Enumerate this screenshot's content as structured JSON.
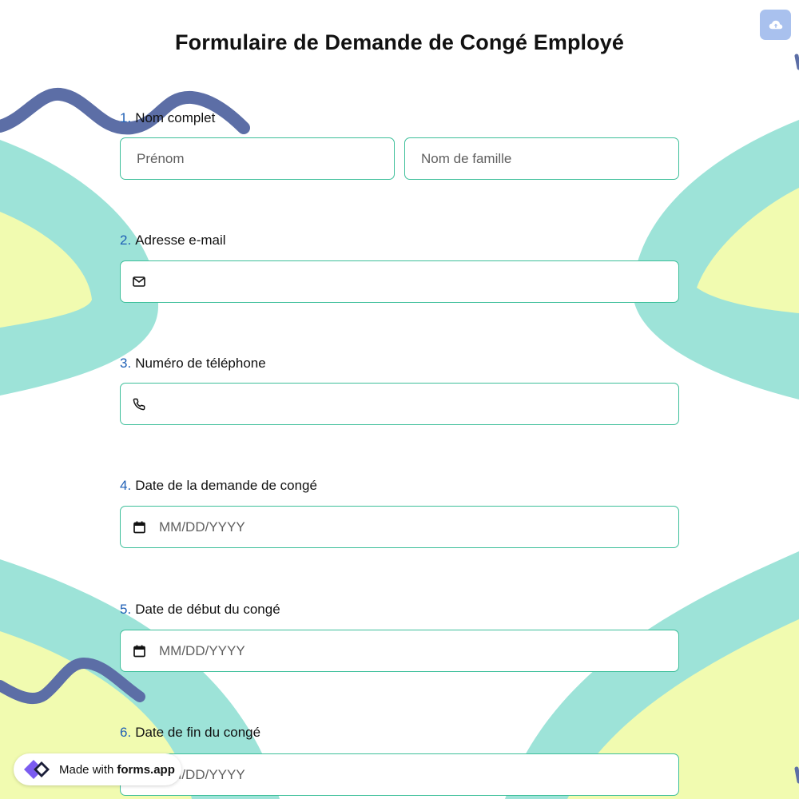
{
  "form": {
    "title": "Formulaire de Demande de Congé Employé"
  },
  "questions": [
    {
      "number": "1.",
      "label": "Nom complet",
      "fields": [
        {
          "placeholder": "Prénom"
        },
        {
          "placeholder": "Nom de famille"
        }
      ]
    },
    {
      "number": "2.",
      "label": "Adresse e-mail",
      "icon": "envelope-icon",
      "value": ""
    },
    {
      "number": "3.",
      "label": "Numéro de téléphone",
      "icon": "phone-icon",
      "value": ""
    },
    {
      "number": "4.",
      "label": "Date de la demande de congé",
      "icon": "calendar-icon",
      "placeholder": "MM/DD/YYYY"
    },
    {
      "number": "5.",
      "label": "Date de début du congé",
      "icon": "calendar-icon",
      "placeholder": "MM/DD/YYYY"
    },
    {
      "number": "6.",
      "label": "Date de fin du congé",
      "icon": "calendar-icon",
      "placeholder": "MM/DD/YYYY"
    }
  ],
  "toolbar": {
    "upload_icon": "cloud-upload-icon"
  },
  "badge": {
    "prefix": "Made with",
    "brand": "forms.app",
    "logo_icon": "forms-app-logo-icon"
  },
  "colors": {
    "accent": "#1e5fb5",
    "field_border": "#3dbf9a",
    "teal_shape": "#9de3d8",
    "yellow_shape": "#f1fbb0",
    "squiggle": "#5c6ea6",
    "upload_button": "#a9c1ee"
  }
}
